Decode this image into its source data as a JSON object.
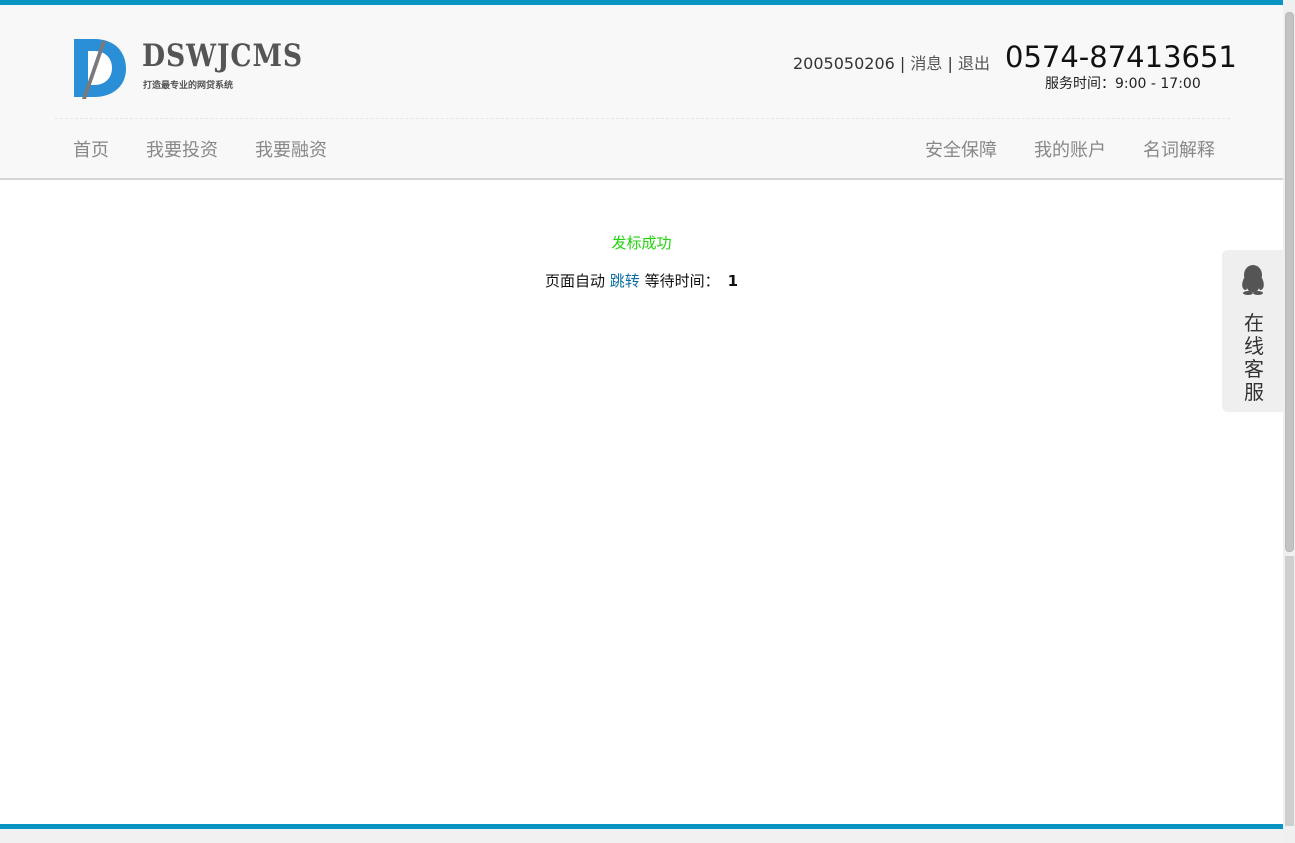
{
  "header": {
    "logo": {
      "text": "DSWJCMS",
      "tagline": "打造最专业的网贷系统",
      "brand_color": "#2a8fd6"
    },
    "user": {
      "id": "2005050206",
      "separator": "|",
      "messages_label": "消息",
      "logout_label": "退出"
    },
    "phone": "0574-87413651",
    "service_time": "服务时间：9:00 - 17:00",
    "nav_left": [
      {
        "label": "首页"
      },
      {
        "label": "我要投资"
      },
      {
        "label": "我要融资"
      }
    ],
    "nav_right": [
      {
        "label": "安全保障"
      },
      {
        "label": "我的账户"
      },
      {
        "label": "名词解释"
      }
    ]
  },
  "main": {
    "success_message": "发标成功",
    "redirect_prefix": "页面自动",
    "redirect_link": "跳转",
    "redirect_wait": "等待时间：",
    "countdown": "1",
    "success_color": "#1fd40b"
  },
  "sidebar_service": {
    "icon": "qq-icon",
    "label": "在线客服"
  },
  "colors": {
    "accent": "#0a94c4",
    "header_bg": "#f8f8f8",
    "link": "#0a6fa5"
  }
}
